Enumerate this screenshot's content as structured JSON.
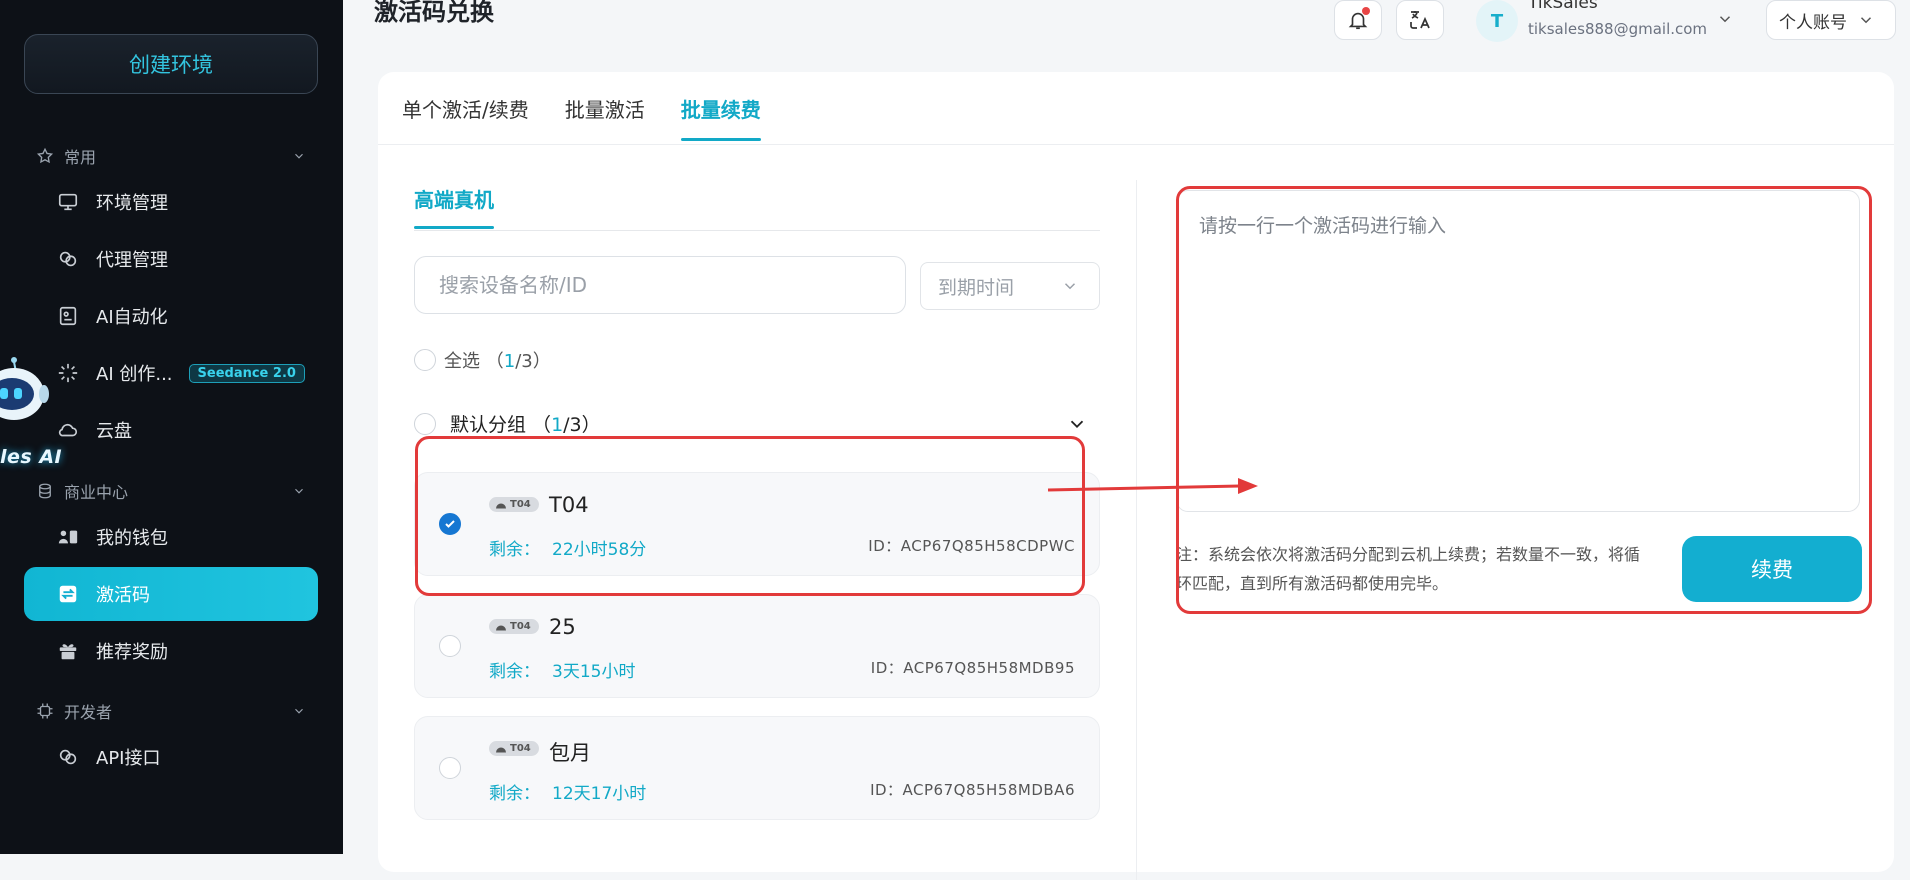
{
  "sidebar": {
    "create_label": "创建环境",
    "robot_label": "les AI",
    "sections": {
      "common": "常用",
      "business": "商业中心",
      "developer": "开发者"
    },
    "items": [
      {
        "key": "env",
        "label": "环境管理"
      },
      {
        "key": "proxy",
        "label": "代理管理"
      },
      {
        "key": "ai_auto",
        "label": "AI自动化"
      },
      {
        "key": "ai_create",
        "label": "AI 创作...",
        "badge": "Seedance 2.0"
      },
      {
        "key": "cloud",
        "label": "云盘"
      },
      {
        "key": "wallet",
        "label": "我的钱包"
      },
      {
        "key": "codes",
        "label": "激活码",
        "active": true
      },
      {
        "key": "referral",
        "label": "推荐奖励"
      },
      {
        "key": "api",
        "label": "API接口"
      }
    ]
  },
  "header": {
    "title": "激活码兑换",
    "user_initial": "T",
    "user_name": "TikSales",
    "user_email": "tiksales888@gmail.com",
    "account_type": "个人账号"
  },
  "tabs": [
    "单个激活/续费",
    "批量激活",
    "批量续费"
  ],
  "active_tab": 2,
  "left_panel": {
    "subtab": "高端真机",
    "search_placeholder": "搜索设备名称/ID",
    "expire_placeholder": "到期时间",
    "select_all": "全选",
    "select_all_count": "（1/3）",
    "select_all_selected": "1",
    "select_all_total": "/3）",
    "group_name": "默认分组",
    "group_selected": "1",
    "group_total": "/3）",
    "remaining_label": "剩余：",
    "devices": [
      {
        "tag": "T04",
        "name": "T04",
        "remaining": "22小时58分",
        "id": "ID：ACP67Q85H58CDPWC",
        "checked": true
      },
      {
        "tag": "T04",
        "name": "25",
        "remaining": "3天15小时",
        "id": "ID：ACP67Q85H58MDB95",
        "checked": false
      },
      {
        "tag": "T04",
        "name": "包月",
        "remaining": "12天17小时",
        "id": "ID：ACP67Q85H58MDBA6",
        "checked": false
      }
    ]
  },
  "right_panel": {
    "codes_placeholder": "请按一行一个激活码进行输入",
    "note": "注：系统会依次将激活码分配到云机上续费；若数量不一致，将循环匹配，直到所有激活码都使用完毕。",
    "renew_label": "续费"
  },
  "colors": {
    "accent": "#12a9c7",
    "sidebar_bg": "#0d1117",
    "annotation": "#e23a3a",
    "check": "#1677d2"
  }
}
